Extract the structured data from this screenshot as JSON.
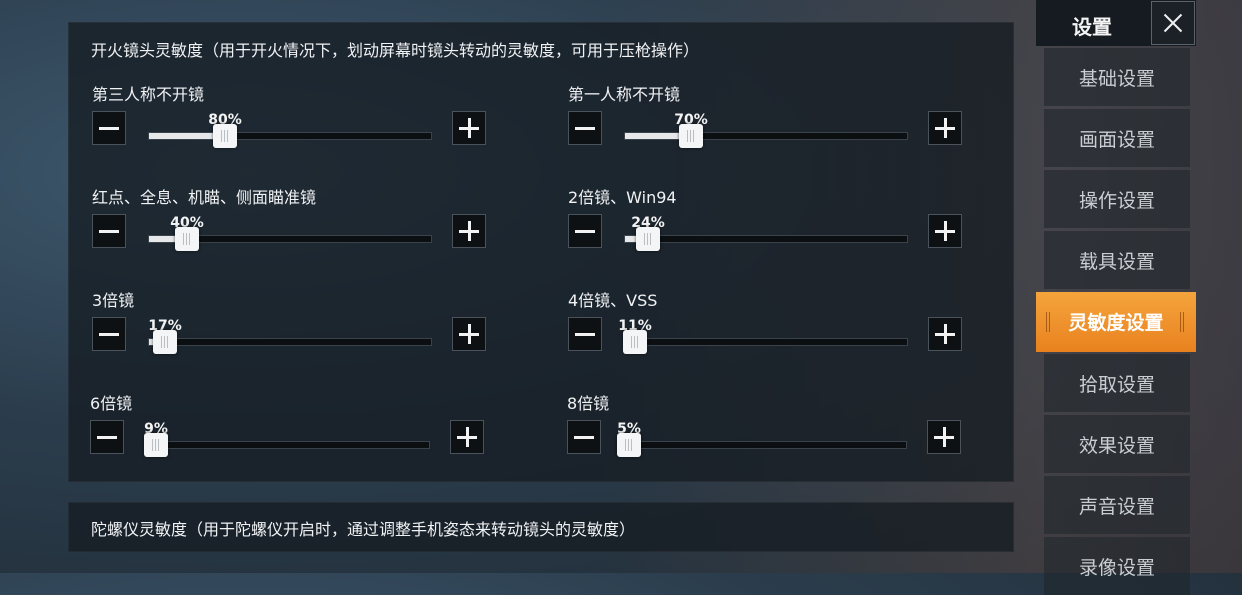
{
  "fire_panel": {
    "title": "开火镜头灵敏度（用于开火情况下，划动屏幕时镜头转动的灵敏度，可用于压枪操作）",
    "controls": [
      {
        "label": "第三人称不开镜",
        "value": 80,
        "value_text": "80%"
      },
      {
        "label": "第一人称不开镜",
        "value": 70,
        "value_text": "70%"
      },
      {
        "label": "红点、全息、机瞄、侧面瞄准镜",
        "value": 40,
        "value_text": "40%"
      },
      {
        "label": "2倍镜、Win94",
        "value": 24,
        "value_text": "24%"
      },
      {
        "label": "3倍镜",
        "value": 17,
        "value_text": "17%"
      },
      {
        "label": "4倍镜、VSS",
        "value": 11,
        "value_text": "11%"
      },
      {
        "label": "6倍镜",
        "value": 9,
        "value_text": "9%"
      },
      {
        "label": "8倍镜",
        "value": 5,
        "value_text": "5%"
      }
    ],
    "slider_max": 300
  },
  "gyro_panel": {
    "title": "陀螺仪灵敏度（用于陀螺仪开启时，通过调整手机姿态来转动镜头的灵敏度）"
  },
  "sidebar": {
    "title": "设置",
    "close_icon": "close-icon",
    "items": [
      {
        "label": "基础设置"
      },
      {
        "label": "画面设置"
      },
      {
        "label": "操作设置"
      },
      {
        "label": "载具设置"
      },
      {
        "label": "灵敏度设置",
        "active": true
      },
      {
        "label": "拾取设置"
      },
      {
        "label": "效果设置"
      },
      {
        "label": "声音设置"
      },
      {
        "label": "录像设置"
      }
    ]
  },
  "colors": {
    "accent": "#f29a32",
    "panel_bg": "#161c23",
    "track_fill": "#e6e8ea"
  }
}
